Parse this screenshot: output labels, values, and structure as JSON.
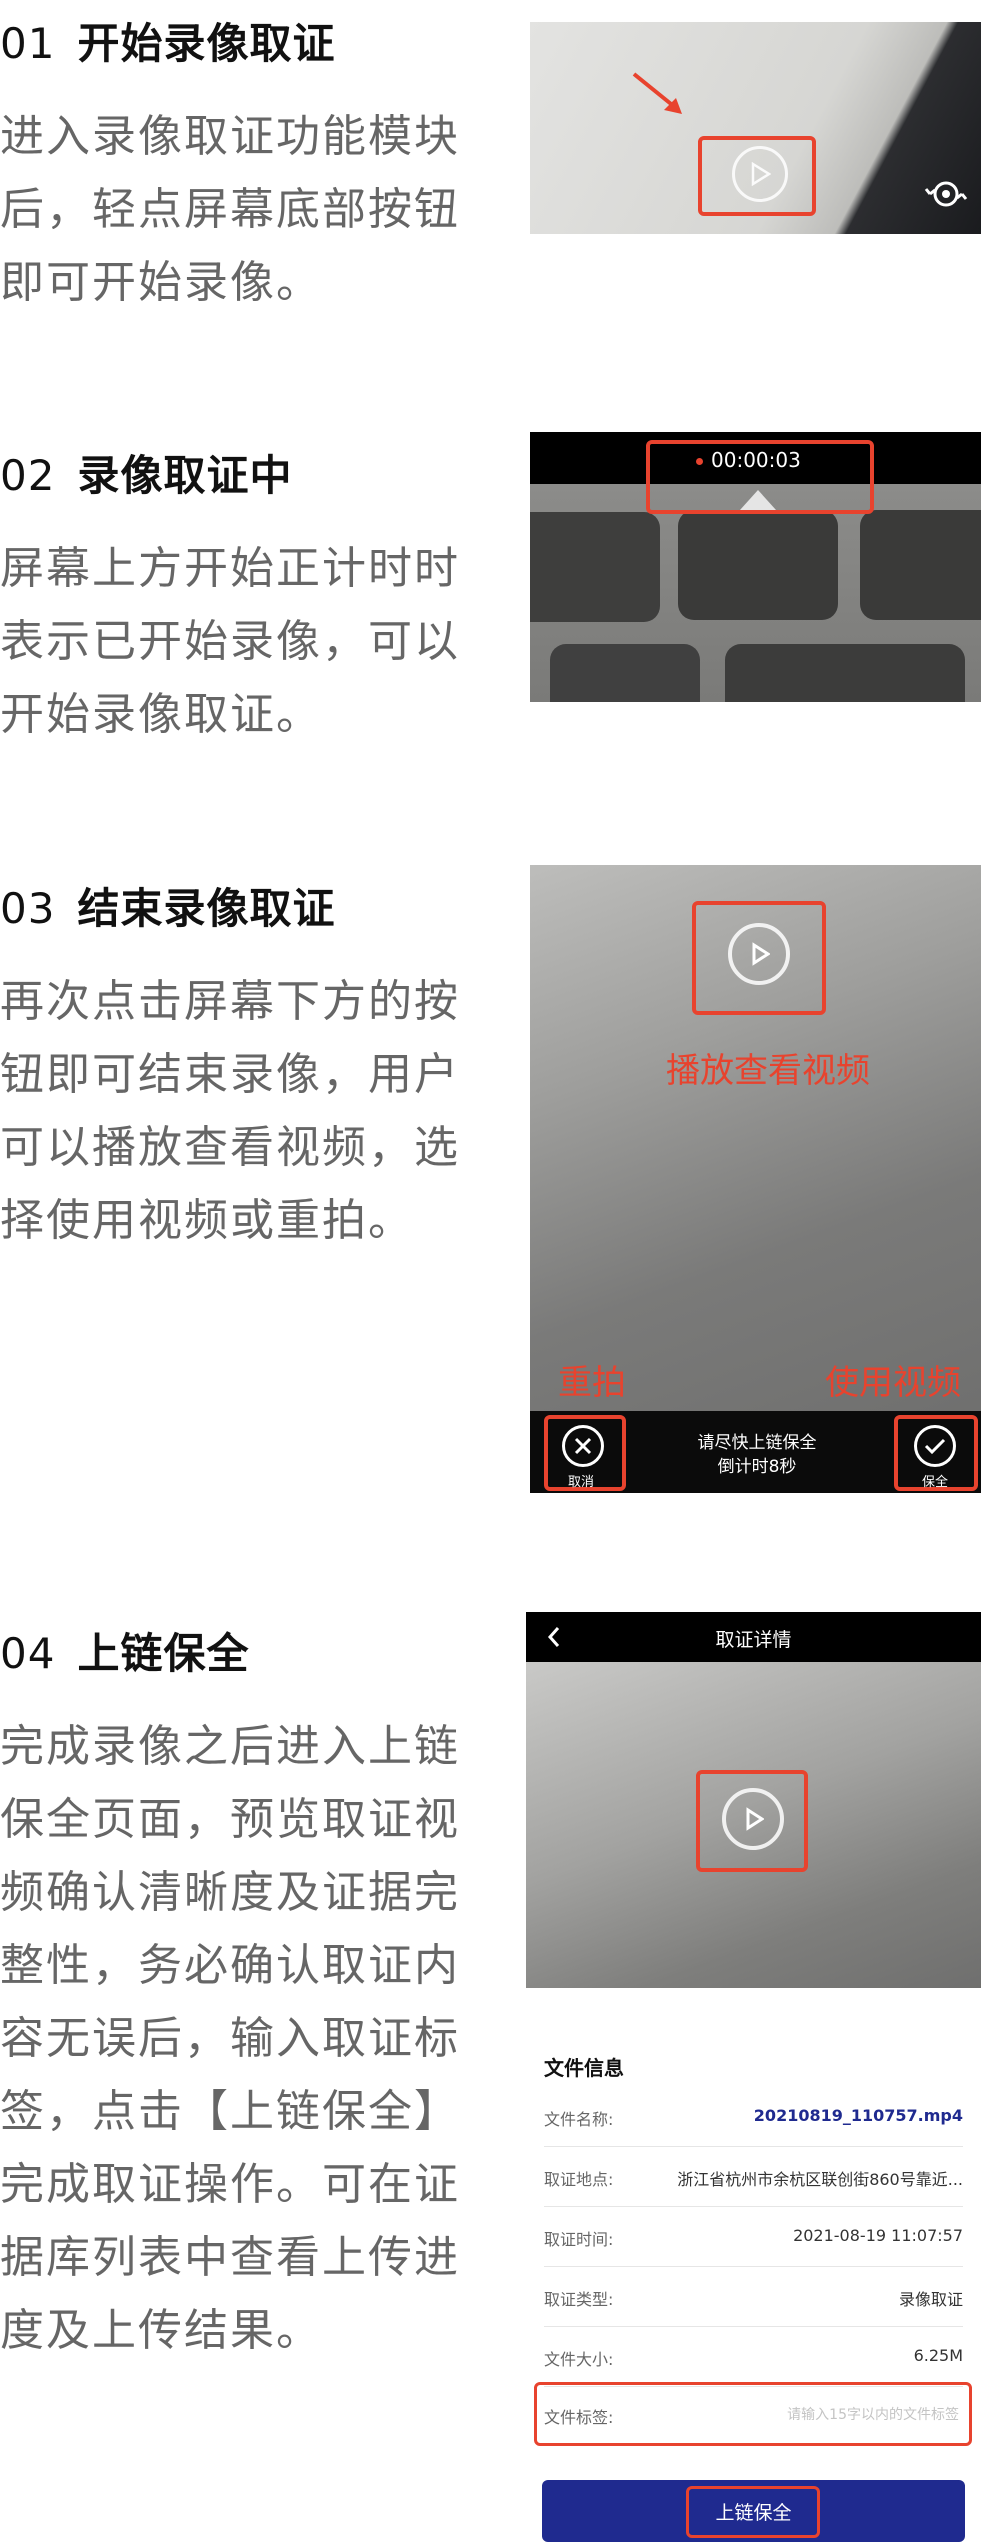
{
  "steps": [
    {
      "num": "01",
      "title": "开始录像取证",
      "desc": "进入录像取证功能模块\n后，轻点屏幕底部按钮\n即可开始录像。"
    },
    {
      "num": "02",
      "title": "录像取证中",
      "desc": "屏幕上方开始正计时时\n表示已开始录像，可以\n开始录像取证。"
    },
    {
      "num": "03",
      "title": "结束录像取证",
      "desc": "再次点击屏幕下方的按\n钮即可结束录像，用户\n可以播放查看视频，选\n择使用视频或重拍。"
    },
    {
      "num": "04",
      "title": "上链保全",
      "desc": "完成录像之后进入上链\n保全页面，预览取证视\n频确认清晰度及证据完\n整性，务必确认取证内\n容无误后，输入取证标\n签，点击【上链保全】\n完成取证操作。可在证\n据库列表中查看上传进\n度及上传结果。"
    }
  ],
  "shot2": {
    "timer": "00:00:03"
  },
  "shot3": {
    "play_label": "播放查看视频",
    "retake_label": "重拍",
    "use_label": "使用视频",
    "hint_line1": "请尽快上链保全",
    "hint_line2": "倒计时8秒",
    "cancel_label": "取消",
    "save_label": "保全"
  },
  "shot4": {
    "header_title": "取证详情",
    "section_title": "文件信息",
    "rows": [
      {
        "k": "文件名称:",
        "v": "20210819_110757.mp4"
      },
      {
        "k": "取证地点:",
        "v": "浙江省杭州市余杭区联创街860号靠近..."
      },
      {
        "k": "取证时间:",
        "v": "2021-08-19 11:07:57"
      },
      {
        "k": "取证类型:",
        "v": "录像取证"
      },
      {
        "k": "文件大小:",
        "v": "6.25M"
      }
    ],
    "tag_label": "文件标签:",
    "tag_placeholder": "请输入15字以内的文件标签",
    "submit_label": "上链保全"
  },
  "colors": {
    "accent_red": "#e8432e",
    "button_blue": "#1f2a8f",
    "link_blue": "#1f2a8f"
  }
}
